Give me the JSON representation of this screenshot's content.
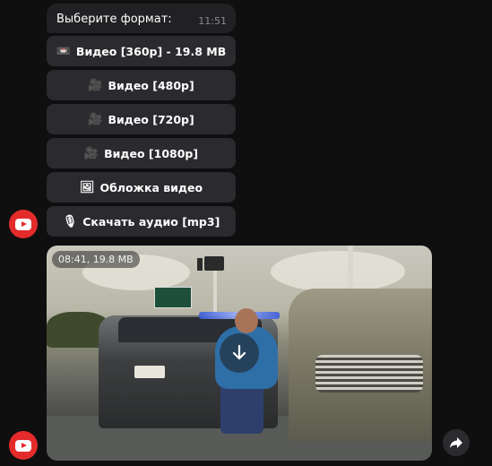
{
  "message": {
    "text": "Выберите формат:",
    "time": "11:51"
  },
  "keyboard": [
    {
      "icon": "📼",
      "label": "Видео [360p] - 19.8 MB"
    },
    {
      "icon": "🎥",
      "label": "Видео [480p]"
    },
    {
      "icon": "🎥",
      "label": "Видео [720p]"
    },
    {
      "icon": "🎥",
      "label": "Видео [1080p]"
    },
    {
      "icon": "🖼",
      "label": "Обложка видео"
    },
    {
      "icon": "🎙",
      "label": "Скачать аудио [mp3]"
    }
  ],
  "video": {
    "meta": "08:41, 19.8 MB"
  },
  "colors": {
    "background": "#0f0f10",
    "bubble": "#212124",
    "button": "#2b2b2f",
    "youtube_red": "#e32b2b"
  }
}
